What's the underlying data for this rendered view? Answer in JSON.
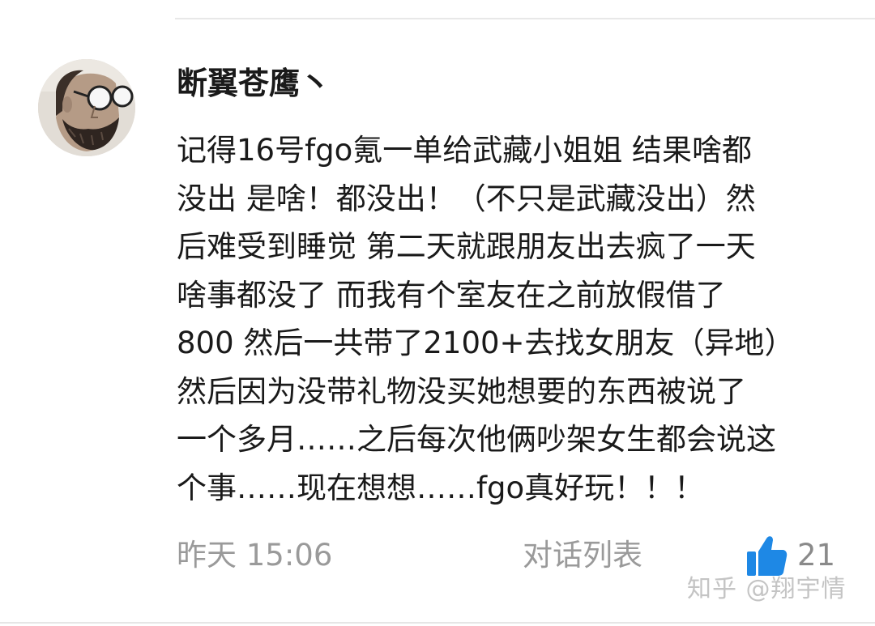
{
  "comment": {
    "author": "断翼苍鹰丶",
    "lines": [
      "记得16号fgo氪一单给武藏小姐姐 结果啥都",
      "没出 是啥！都没出！（不只是武藏没出）然",
      "后难受到睡觉 第二天就跟朋友出去疯了一天",
      "啥事都没了 而我有个室友在之前放假借了",
      "800 然后一共带了2100+去找女朋友（异地）",
      "然后因为没带礼物没买她想要的东西被说了",
      "一个多月……之后每次他俩吵架女生都会说这",
      "个事……现在想想……fgo真好玩！！！"
    ],
    "timestamp": "昨天 15:06",
    "conversation_label": "对话列表",
    "like_count": "21"
  },
  "watermark": "知乎 @翔宇情",
  "icons": {
    "avatar": "avatar-portrait",
    "like": "thumbs-up-icon"
  },
  "colors": {
    "text": "#1a1a1a",
    "meta": "#9a9a9a",
    "like_icon": "#1e88e5",
    "watermark": "#c4c4c4"
  }
}
